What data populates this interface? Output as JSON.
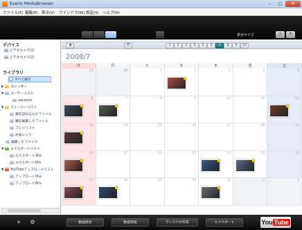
{
  "window": {
    "title": "Everio MediaBrowser",
    "minimize": "–",
    "maximize": "□",
    "close": "✕"
  },
  "menu": [
    "ファイル(F)",
    "編集(E)",
    "表示(V)",
    "ウインドウ(W)",
    "設定(S)",
    "ヘルプ(H)"
  ],
  "toolbar": {
    "zoom_label": "表示サイズ",
    "zoom_small": "小",
    "zoom_large": "大"
  },
  "sidebar": {
    "devices_heading": "デバイス",
    "devices": [
      "ビデオカメラ(1)",
      "ビデオカメラ(2)"
    ],
    "library_heading": "ライブラリ",
    "items": [
      {
        "label": "すべて表示",
        "selected": true
      },
      {
        "label": "カレンダー"
      },
      {
        "label": "ユーザーリスト"
      },
      {
        "label": "vacation"
      },
      {
        "label": "ストーリーリスト"
      },
      {
        "label": "最近読み込んだファイル"
      },
      {
        "label": "最近編集したファイル"
      },
      {
        "label": "プレイリスト"
      },
      {
        "label": "お気に入り"
      },
      {
        "label": "編集したファイル"
      },
      {
        "label": "エクスポートリスト"
      },
      {
        "label": "エクスポート済み"
      },
      {
        "label": "エクスポート待ち"
      },
      {
        "label": "YouTubeアップロードリスト"
      },
      {
        "label": "アップロード済み"
      },
      {
        "label": "アップロード待ち"
      }
    ]
  },
  "calendar": {
    "month_title": "2008/7",
    "nav_buttons": [
      "◀",
      "月",
      "1",
      "2",
      "3",
      "4",
      "5",
      "6",
      "7",
      "8",
      "9",
      "10"
    ],
    "active_nav": "7",
    "weekdays": [
      "日",
      "月",
      "火",
      "水",
      "木",
      "金",
      "土"
    ],
    "weeks": [
      [
        "29",
        "30",
        "1",
        "2",
        "3",
        "4",
        "5"
      ],
      [
        "6",
        "7",
        "8",
        "9",
        "10",
        "11",
        "12"
      ],
      [
        "13",
        "14",
        "15",
        "16",
        "17",
        "18",
        "19"
      ],
      [
        "20",
        "21",
        "22",
        "23",
        "24",
        "25",
        "26"
      ],
      [
        "27",
        "28",
        "29",
        "30",
        "31",
        "1",
        "2"
      ]
    ],
    "thumbs": [
      {
        "week": 0,
        "day": 3,
        "color": "#a8504a"
      },
      {
        "week": 1,
        "day": 0,
        "color": "#3b4a5a"
      },
      {
        "week": 1,
        "day": 1,
        "color": "#4f5e4c"
      },
      {
        "week": 1,
        "day": 6,
        "color": "#6a3c2c"
      },
      {
        "week": 2,
        "day": 0,
        "color": "#5a3a36"
      },
      {
        "week": 3,
        "day": 0,
        "color": "#b3584a"
      },
      {
        "week": 3,
        "day": 4,
        "color": "#3e5a88"
      },
      {
        "week": 3,
        "day": 5,
        "color": "#5a6c8a"
      },
      {
        "week": 4,
        "day": 0,
        "color": "#8a4a5a"
      },
      {
        "week": 4,
        "day": 1,
        "color": "#2f4a6a"
      },
      {
        "week": 4,
        "day": 4,
        "color": "#6a7076"
      }
    ]
  },
  "bottom": {
    "add": "+",
    "tools": "⚙",
    "buttons": [
      "動画統合",
      "動画変換",
      "ディスクの作成",
      "エクスポート"
    ],
    "youtube_you": "You",
    "youtube_tube": "Tube"
  }
}
